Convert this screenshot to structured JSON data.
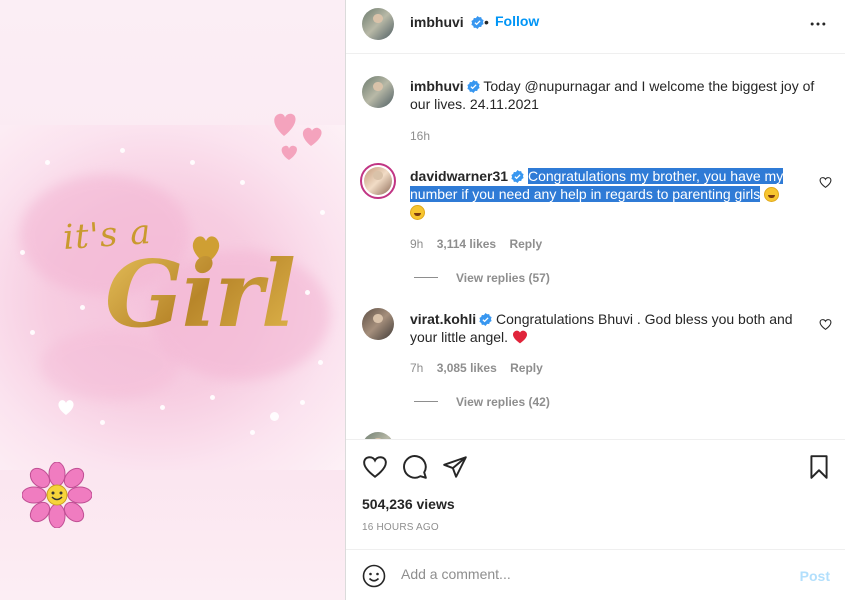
{
  "header": {
    "username": "imbhuvi",
    "verified_icon": "verified-badge-icon",
    "separator": "•",
    "follow_label": "Follow"
  },
  "media": {
    "overlay_small": "it's a",
    "overlay_big": "Girl"
  },
  "caption": {
    "username": "imbhuvi",
    "text": "Today @nupurnagar and I welcome the biggest joy of our lives. 24.11.2021",
    "time": "16h"
  },
  "comments": [
    {
      "username": "davidwarner31",
      "text": "Congratulations my brother, you have my number if you need any help in regards to parenting girls",
      "time": "9h",
      "likes": "3,114 likes",
      "reply": "Reply",
      "view_replies": "View replies (57)"
    },
    {
      "username": "virat.kohli",
      "text": "Congratulations Bhuvi . God bless you both and your little angel.",
      "time": "7h",
      "likes": "3,085 likes",
      "reply": "Reply",
      "view_replies": "View replies (42)"
    }
  ],
  "actions": {
    "views": "504,236 views",
    "posted_ago": "16 HOURS AGO"
  },
  "composer": {
    "placeholder": "Add a comment...",
    "post_label": "Post"
  },
  "colors": {
    "link_blue": "#0095f6",
    "highlight": "#2f7bd6",
    "muted": "#8e8e8e",
    "post_disabled": "#b2dffc"
  }
}
